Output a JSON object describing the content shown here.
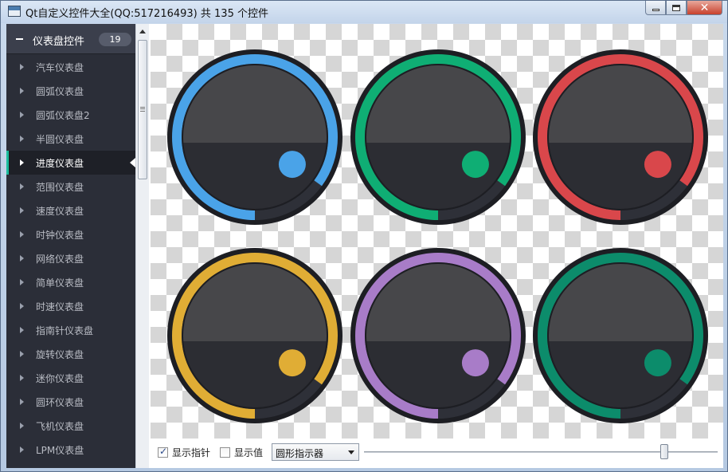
{
  "window": {
    "title": "Qt自定义控件大全(QQ:517216493) 共 135 个控件",
    "close_glyph": "✕"
  },
  "sidebar": {
    "group": {
      "label": "仪表盘控件",
      "count": "19",
      "icon": "collapse-minus-icon"
    },
    "items": [
      {
        "label": "汽车仪表盘",
        "active": false
      },
      {
        "label": "圆弧仪表盘",
        "active": false
      },
      {
        "label": "圆弧仪表盘2",
        "active": false
      },
      {
        "label": "半圆仪表盘",
        "active": false
      },
      {
        "label": "进度仪表盘",
        "active": true
      },
      {
        "label": "范围仪表盘",
        "active": false
      },
      {
        "label": "速度仪表盘",
        "active": false
      },
      {
        "label": "时钟仪表盘",
        "active": false
      },
      {
        "label": "网络仪表盘",
        "active": false
      },
      {
        "label": "简单仪表盘",
        "active": false
      },
      {
        "label": "时速仪表盘",
        "active": false
      },
      {
        "label": "指南针仪表盘",
        "active": false
      },
      {
        "label": "旋转仪表盘",
        "active": false
      },
      {
        "label": "迷你仪表盘",
        "active": false
      },
      {
        "label": "圆环仪表盘",
        "active": false
      },
      {
        "label": "飞机仪表盘",
        "active": false
      },
      {
        "label": "LPM仪表盘",
        "active": false
      }
    ],
    "accent_color": "#1abc9c"
  },
  "gauges": [
    {
      "color": "#4aa3e8",
      "progress": 0.85
    },
    {
      "color": "#0fae74",
      "progress": 0.85
    },
    {
      "color": "#d9474b",
      "progress": 0.85
    },
    {
      "color": "#e0ad35",
      "progress": 0.85
    },
    {
      "color": "#a87cc8",
      "progress": 0.85
    },
    {
      "color": "#0c8c6b",
      "progress": 0.85
    }
  ],
  "controls": {
    "show_pointer": {
      "label": "显示指针",
      "checked": true
    },
    "show_value": {
      "label": "显示值",
      "checked": false
    },
    "indicator_style": {
      "value": "圆形指示器"
    },
    "slider": {
      "value": 0.85
    },
    "check_glyph": "✓"
  }
}
